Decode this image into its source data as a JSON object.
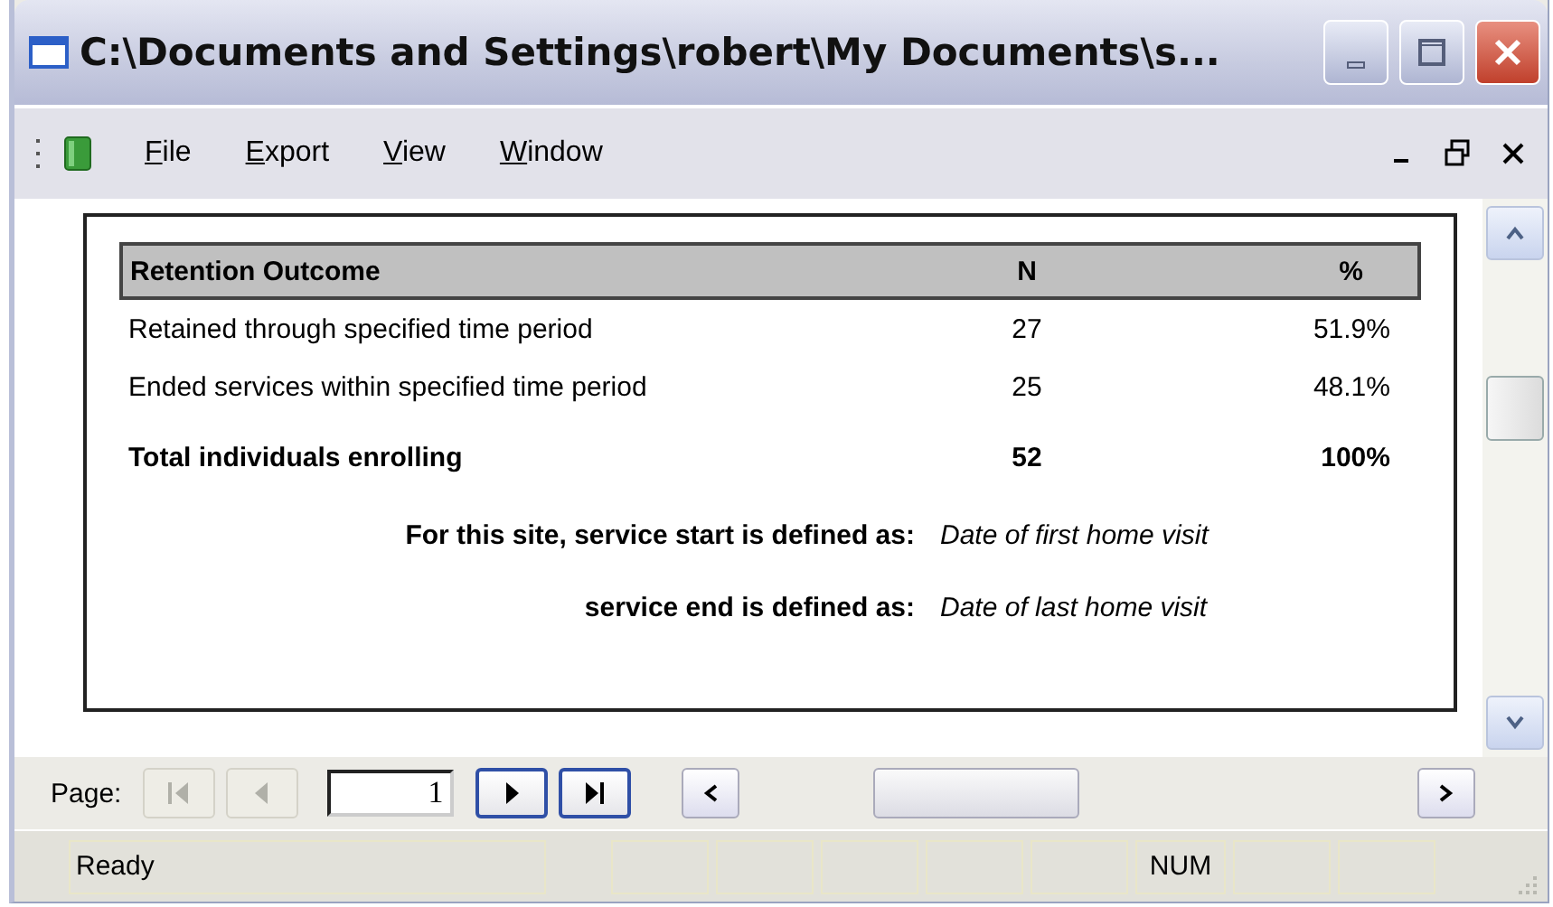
{
  "window": {
    "title": "C:\\Documents and Settings\\robert\\My Documents\\s..."
  },
  "menu": [
    "File",
    "Export",
    "View",
    "Window"
  ],
  "report": {
    "columns": [
      "Retention Outcome",
      "N",
      "%"
    ],
    "rows": [
      {
        "kind": "normal",
        "cells": [
          "Retained through specified time period",
          "27",
          "51.9%"
        ]
      },
      {
        "kind": "normal",
        "cells": [
          "Ended services within specified time period",
          "25",
          "48.1%"
        ]
      },
      {
        "kind": "total",
        "cells": [
          "Total individuals enrolling",
          "52",
          "100%"
        ]
      }
    ],
    "definitions": [
      {
        "label": "For this site, service start is defined as:",
        "value": "Date of first home visit"
      },
      {
        "label": "service end is defined as:",
        "value": "Date of last home visit"
      }
    ]
  },
  "pager": {
    "label": "Page:",
    "value": "1",
    "buttons": [
      {
        "kind": "first",
        "disabled": true
      },
      {
        "kind": "prev",
        "disabled": true
      },
      {
        "kind": "next",
        "disabled": false
      },
      {
        "kind": "last",
        "disabled": false
      }
    ]
  },
  "status_bar": {
    "text": "Ready",
    "indicator": "NUM"
  }
}
